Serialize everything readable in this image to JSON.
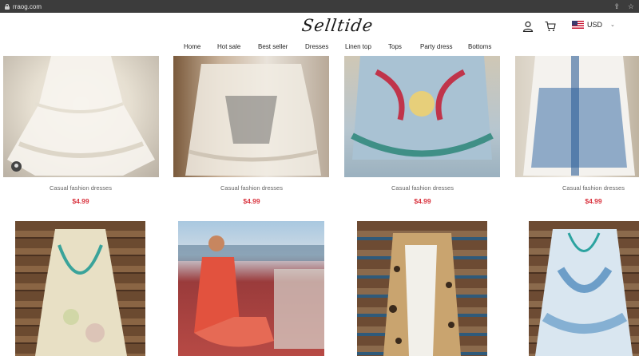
{
  "browser": {
    "url": "rraog.com",
    "share_icon": "share-icon",
    "star_icon": "star-icon"
  },
  "header": {
    "logo": "Selltide",
    "account_icon": "user-icon",
    "cart_icon": "cart-icon",
    "currency": "USD"
  },
  "nav": {
    "items": [
      "Home",
      "Hot sale",
      "Best seller",
      "Dresses",
      "Linen top",
      "Tops",
      "Party dress",
      "Bottoms"
    ]
  },
  "products_row1": [
    {
      "name": "Casual fashion dresses",
      "price": "$4.99"
    },
    {
      "name": "Casual fashion dresses",
      "price": "$4.99"
    },
    {
      "name": "Casual fashion dresses",
      "price": "$4.99"
    },
    {
      "name": "Casual fashion dresses",
      "price": "$4.99"
    }
  ],
  "colors": {
    "price": "#d9343f",
    "chrome": "#3c3c3c"
  }
}
